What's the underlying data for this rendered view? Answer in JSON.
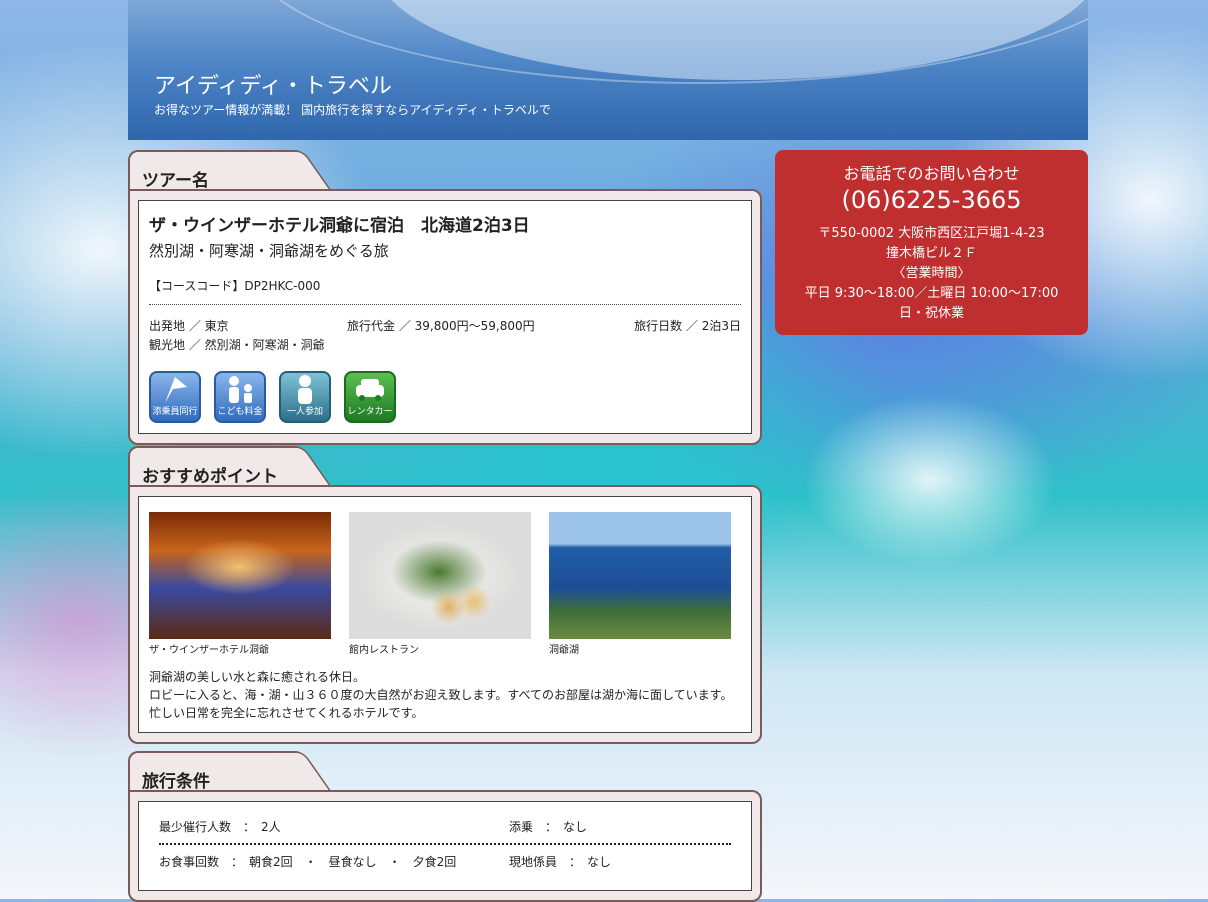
{
  "header": {
    "title": "アイディディ・トラベル",
    "subtitle": "お得なツアー情報が満載！ 国内旅行を探すならアイディディ・トラベルで"
  },
  "tour": {
    "tab_label": "ツアー名",
    "title": "ザ・ウインザーホテル洞爺に宿泊　北海道2泊3日",
    "subtitle": "然別湖・阿寒湖・洞爺湖をめぐる旅",
    "course_code": "【コースコード】DP2HKC-000",
    "departure": "出発地 ／ 東京",
    "price": "旅行代金 ／ 39,800円〜59,800円",
    "days": "旅行日数 ／ 2泊3日",
    "sightseeing": "観光地 ／ 然別湖・阿寒湖・洞爺",
    "icons": [
      {
        "name": "flag-icon",
        "label": "添乗員同行"
      },
      {
        "name": "family-icon",
        "label": "こども料金"
      },
      {
        "name": "person-icon",
        "label": "一人参加"
      },
      {
        "name": "car-icon",
        "label": "レンタカー"
      }
    ]
  },
  "recommend": {
    "tab_label": "おすすめポイント",
    "photos": [
      {
        "caption": "ザ・ウインザーホテル洞爺"
      },
      {
        "caption": "館内レストラン"
      },
      {
        "caption": "洞爺湖"
      }
    ],
    "lines": [
      "洞爺湖の美しい水と森に癒される休日。",
      "ロビーに入ると、海・湖・山３６０度の大自然がお迎え致します。すべてのお部屋は湖か海に面しています。",
      "忙しい日常を完全に忘れさせてくれるホテルです。"
    ]
  },
  "conditions": {
    "tab_label": "旅行条件",
    "row1_left": "最少催行人数　：　2人",
    "row1_right": "添乗　：　なし",
    "row2_left": "お食事回数　：　朝食2回　・　昼食なし　・　夕食2回",
    "row2_right": "現地係員　：　なし"
  },
  "contact": {
    "heading": "お電話でのお問い合わせ",
    "phone": "(06)6225-3665",
    "address1": "〒550-0002 大阪市西区江戸堀1-4-23",
    "address2": "撞木橋ビル２Ｆ",
    "hours_label": "〈営業時間〉",
    "hours": "平日 9:30〜18:00／土曜日 10:00〜17:00",
    "closed": "日・祝休業"
  }
}
